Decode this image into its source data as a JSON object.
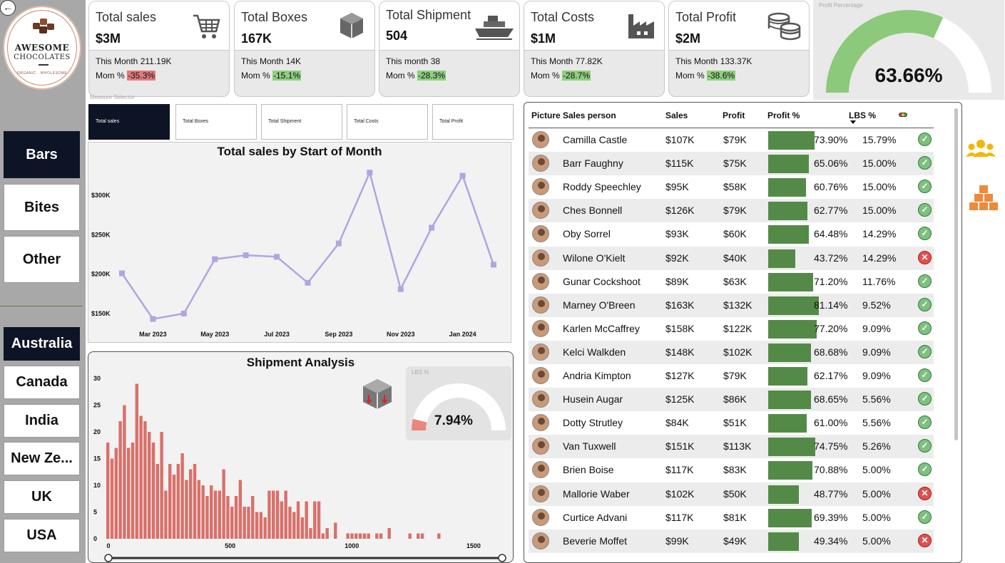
{
  "logo": {
    "line1": "AWESOME",
    "line2": "CHOCOLATES",
    "tagline": "ORGANIC · WHOLESOME"
  },
  "categories": [
    {
      "label": "Bars",
      "active": true
    },
    {
      "label": "Bites",
      "active": false
    },
    {
      "label": "Other",
      "active": false
    }
  ],
  "countries": [
    {
      "label": "Australia",
      "active": true
    },
    {
      "label": "Canada",
      "active": false
    },
    {
      "label": "India",
      "active": false
    },
    {
      "label": "New Ze...",
      "active": false
    },
    {
      "label": "UK",
      "active": false
    },
    {
      "label": "USA",
      "active": false
    }
  ],
  "kpis": [
    {
      "title": "Total sales",
      "value": "$3M",
      "month": "This Month 211.19K",
      "mom_label": "Mom % ",
      "mom": "-35.3%",
      "mom_color": "#e07a7a",
      "icon": "cart-icon"
    },
    {
      "title": "Total Boxes",
      "value": "167K",
      "month": "This Month 14K",
      "mom_label": "Mom % ",
      "mom": "-15.1%",
      "mom_color": "#8fcf7f",
      "icon": "box-icon"
    },
    {
      "title": "Total Shipment",
      "value": "504",
      "month": "This month 38",
      "mom_label": "Mom % ",
      "mom": "-28.3%",
      "mom_color": "#8fcf7f",
      "icon": "ship-icon"
    },
    {
      "title": "Total Costs",
      "value": "$1M",
      "month": "This Month 77.82K",
      "mom_label": "Mom % ",
      "mom": "-28.7%",
      "mom_color": "#8fcf7f",
      "icon": "factory-icon"
    },
    {
      "title": "Total Profit",
      "value": "$2M",
      "month": "This Month 133.37K",
      "mom_label": "Mom % ",
      "mom": "-38.6%",
      "mom_color": "#8fcf7f",
      "icon": "coins-icon"
    }
  ],
  "profit_gauge": {
    "label": "Profit Percentage",
    "value": "63.66%",
    "fraction": 0.6366,
    "color": "#8cc97a"
  },
  "measure_selector": {
    "label": "Measure Selector",
    "options": [
      "Total sales",
      "Total Boxes",
      "Total Shipment",
      "Total Costs",
      "Total Profit"
    ],
    "active": 0
  },
  "line_chart_title": "Total sales by Start of Month",
  "shipment_title": "Shipment Analysis",
  "lbs_gauge": {
    "label": "LBS %",
    "value": "7.94%",
    "fraction": 0.0794,
    "color": "#e8877a"
  },
  "table": {
    "headers": [
      "Picture",
      "Sales person",
      "Sales",
      "Profit",
      "Profit %",
      "LBS %"
    ],
    "rows": [
      {
        "name": "Camilla Castle",
        "sales": "$107K",
        "profit": "$79K",
        "profit_pct": "73.90%",
        "lbs": "15.79%",
        "ok": true,
        "frac": 0.739
      },
      {
        "name": "Barr Faughny",
        "sales": "$115K",
        "profit": "$75K",
        "profit_pct": "65.06%",
        "lbs": "15.00%",
        "ok": true,
        "frac": 0.6506
      },
      {
        "name": "Roddy Speechley",
        "sales": "$95K",
        "profit": "$58K",
        "profit_pct": "60.76%",
        "lbs": "15.00%",
        "ok": true,
        "frac": 0.6076
      },
      {
        "name": "Ches Bonnell",
        "sales": "$126K",
        "profit": "$79K",
        "profit_pct": "62.77%",
        "lbs": "15.00%",
        "ok": true,
        "frac": 0.6277
      },
      {
        "name": "Oby Sorrel",
        "sales": "$93K",
        "profit": "$60K",
        "profit_pct": "64.48%",
        "lbs": "14.29%",
        "ok": true,
        "frac": 0.6448
      },
      {
        "name": "Wilone O'Kielt",
        "sales": "$92K",
        "profit": "$40K",
        "profit_pct": "43.72%",
        "lbs": "14.29%",
        "ok": false,
        "frac": 0.4372
      },
      {
        "name": "Gunar Cockshoot",
        "sales": "$89K",
        "profit": "$63K",
        "profit_pct": "71.20%",
        "lbs": "11.76%",
        "ok": true,
        "frac": 0.712
      },
      {
        "name": "Marney O'Breen",
        "sales": "$163K",
        "profit": "$132K",
        "profit_pct": "81.14%",
        "lbs": "9.52%",
        "ok": true,
        "frac": 0.8114
      },
      {
        "name": "Karlen McCaffrey",
        "sales": "$158K",
        "profit": "$122K",
        "profit_pct": "77.20%",
        "lbs": "9.09%",
        "ok": true,
        "frac": 0.772
      },
      {
        "name": "Kelci Walkden",
        "sales": "$148K",
        "profit": "$102K",
        "profit_pct": "68.68%",
        "lbs": "9.09%",
        "ok": true,
        "frac": 0.6868
      },
      {
        "name": "Andria Kimpton",
        "sales": "$127K",
        "profit": "$79K",
        "profit_pct": "62.17%",
        "lbs": "9.09%",
        "ok": true,
        "frac": 0.6217
      },
      {
        "name": "Husein Augar",
        "sales": "$125K",
        "profit": "$86K",
        "profit_pct": "68.65%",
        "lbs": "5.56%",
        "ok": true,
        "frac": 0.6865
      },
      {
        "name": "Dotty Strutley",
        "sales": "$84K",
        "profit": "$51K",
        "profit_pct": "61.00%",
        "lbs": "5.56%",
        "ok": true,
        "frac": 0.61
      },
      {
        "name": "Van Tuxwell",
        "sales": "$151K",
        "profit": "$113K",
        "profit_pct": "74.75%",
        "lbs": "5.26%",
        "ok": true,
        "frac": 0.7475
      },
      {
        "name": "Brien Boise",
        "sales": "$117K",
        "profit": "$83K",
        "profit_pct": "70.88%",
        "lbs": "5.00%",
        "ok": true,
        "frac": 0.7088
      },
      {
        "name": "Mallorie Waber",
        "sales": "$102K",
        "profit": "$50K",
        "profit_pct": "48.77%",
        "lbs": "5.00%",
        "ok": false,
        "frac": 0.4877
      },
      {
        "name": "Curtice Advani",
        "sales": "$117K",
        "profit": "$81K",
        "profit_pct": "69.39%",
        "lbs": "5.00%",
        "ok": true,
        "frac": 0.6939
      },
      {
        "name": "Beverie Moffet",
        "sales": "$99K",
        "profit": "$49K",
        "profit_pct": "49.34%",
        "lbs": "5.00%",
        "ok": false,
        "frac": 0.4934
      }
    ],
    "bar_color": "#548a48"
  },
  "chart_data": [
    {
      "type": "line",
      "title": "Total sales by Start of Month",
      "x": [
        "Feb 2023",
        "Mar 2023",
        "Apr 2023",
        "May 2023",
        "Jun 2023",
        "Jul 2023",
        "Aug 2023",
        "Sep 2023",
        "Oct 2023",
        "Nov 2023",
        "Dec 2023",
        "Jan 2024",
        "Feb 2024"
      ],
      "x_tick_labels": [
        "Mar 2023",
        "May 2023",
        "Jul 2023",
        "Sep 2023",
        "Nov 2023",
        "Jan 2024"
      ],
      "series": [
        {
          "values": [
            201,
            143,
            150,
            219,
            224,
            222,
            189,
            239,
            329,
            181,
            259,
            325,
            212
          ]
        }
      ],
      "y_unit": "K",
      "y_tick_labels": [
        "$150K",
        "$200K",
        "$250K",
        "$300K"
      ],
      "y_ticks": [
        150,
        200,
        250,
        300
      ],
      "ylim": [
        130,
        340
      ],
      "color": "#b3a4e0",
      "grid": false
    },
    {
      "type": "bar",
      "title": "Shipment Analysis",
      "x_tick_labels": [
        "0",
        "500",
        "1000",
        "1500"
      ],
      "x_ticks": [
        0,
        500,
        1000,
        1500
      ],
      "xlim": [
        0,
        1600
      ],
      "y_tick_labels": [
        "0",
        "5",
        "10",
        "15",
        "20",
        "25",
        "30"
      ],
      "y_ticks": [
        0,
        5,
        10,
        15,
        20,
        25,
        30
      ],
      "ylim": [
        0,
        30
      ],
      "bin_width": 17,
      "bin_starts": [
        0,
        17,
        34,
        51,
        68,
        85,
        102,
        119,
        136,
        153,
        170,
        187,
        204,
        221,
        238,
        255,
        272,
        289,
        306,
        323,
        340,
        357,
        374,
        391,
        408,
        425,
        442,
        459,
        476,
        493,
        510,
        527,
        544,
        561,
        578,
        595,
        612,
        629,
        646,
        663,
        680,
        697,
        714,
        731,
        748,
        765,
        782,
        799,
        816,
        833,
        850,
        867,
        884,
        901,
        935,
        986,
        1003,
        1020,
        1037,
        1054,
        1071,
        1105,
        1122,
        1156,
        1241,
        1275,
        1292,
        1360
      ],
      "values": [
        18,
        15,
        17,
        22,
        25,
        17,
        18,
        29,
        23,
        22,
        20,
        18,
        14,
        20,
        9,
        14,
        12,
        14,
        16,
        11,
        13,
        14,
        11,
        10,
        8,
        10,
        9,
        9,
        13,
        8,
        6,
        8,
        11,
        6,
        6,
        8,
        5,
        5,
        4,
        9,
        9,
        9,
        7,
        9,
        6,
        5,
        7,
        4,
        7,
        2,
        7,
        7,
        1,
        2,
        3,
        1,
        1,
        1,
        1,
        1,
        1,
        1,
        1,
        2,
        1,
        1,
        1,
        1
      ],
      "color": "#d9706a"
    }
  ]
}
